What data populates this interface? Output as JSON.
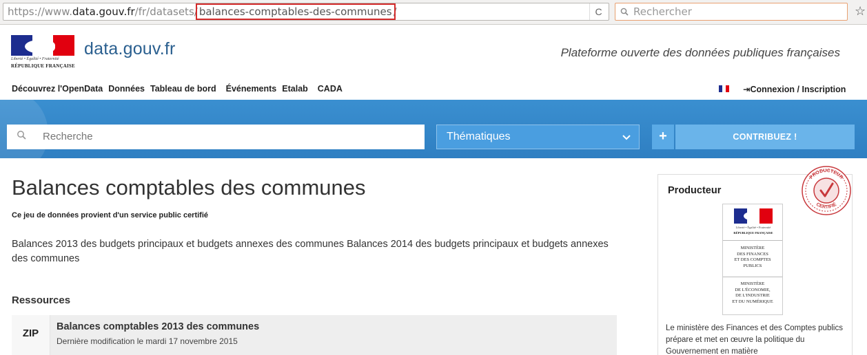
{
  "browser": {
    "url_prefix": "https://www.",
    "url_domain": "data.gouv.fr",
    "url_path": "/fr/datasets/",
    "url_slug": "balances-comptables-des-communes",
    "url_suffix": "/",
    "search_placeholder": "Rechercher",
    "reload_icon": "reload-icon",
    "bookmark_icon": "star-icon"
  },
  "header": {
    "logo_motto": "Liberté • Égalité • Fraternité",
    "logo_republic": "RÉPUBLIQUE FRANÇAISE",
    "site_name": "data.gouv.fr",
    "tagline": "Plateforme ouverte des données publiques françaises"
  },
  "nav": {
    "items": [
      "Découvrez l'OpenData",
      "Données",
      "Tableau de bord",
      "Événements",
      "Etalab",
      "CADA"
    ],
    "login": "Connexion / Inscription"
  },
  "searchbar": {
    "placeholder": "Recherche",
    "themes": "Thématiques",
    "plus": "+",
    "contribute": "CONTRIBUEZ !"
  },
  "dataset": {
    "title": "Balances comptables des communes",
    "certified_note": "Ce jeu de données provient d'un service public certifié",
    "description": "Balances 2013 des budgets principaux et budgets annexes des communes Balances 2014 des budgets principaux et budgets annexes des communes"
  },
  "resources": {
    "heading": "Ressources",
    "items": [
      {
        "format": "ZIP",
        "title": "Balances comptables 2013 des communes",
        "modified": "Dernière modification le mardi 17 novembre 2015"
      }
    ]
  },
  "producer": {
    "heading": "Producteur",
    "logo_motto": "Liberté • Égalité • Fraternité",
    "logo_republic": "RÉPUBLIQUE FRANÇAISE",
    "ministry_finances": "MINISTÈRE\nDES FINANCES\nET DES COMPTES\nPUBLICS",
    "ministry_economie": "MINISTÈRE\nDE L'ÉCONOMIE,\nDE L'INDUSTRIE\nET DU NUMÉRIQUE",
    "description": "Le ministère des Finances et des Comptes publics prépare et met en œuvre la politique du Gouvernement en matière",
    "seal_top": "PRODUCTEUR",
    "seal_bottom": "CERTIFIÉ"
  },
  "colors": {
    "band_blue": "#2f7fc2",
    "flag_blue": "#1d2d8f",
    "flag_red": "#e1000f",
    "seal_red": "#c8383c",
    "url_highlight": "#d42a2a"
  }
}
